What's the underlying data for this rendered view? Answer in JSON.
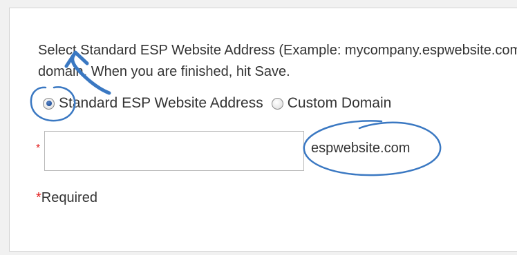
{
  "form": {
    "instruction_line1": "Select Standard ESP Website Address (Example: mycompany.espwebsite.com) or Custom",
    "instruction_line2": "domain. When you are finished, hit Save.",
    "options": [
      {
        "label": "Standard ESP Website Address",
        "selected": true
      },
      {
        "label": "Custom Domain",
        "selected": false
      }
    ],
    "required_marker": "*",
    "domain_input_value": "",
    "domain_suffix": "espwebsite.com",
    "required_note": "Required"
  },
  "colors": {
    "annotation_blue": "#3a78c2",
    "required_red": "#e21f1f"
  }
}
